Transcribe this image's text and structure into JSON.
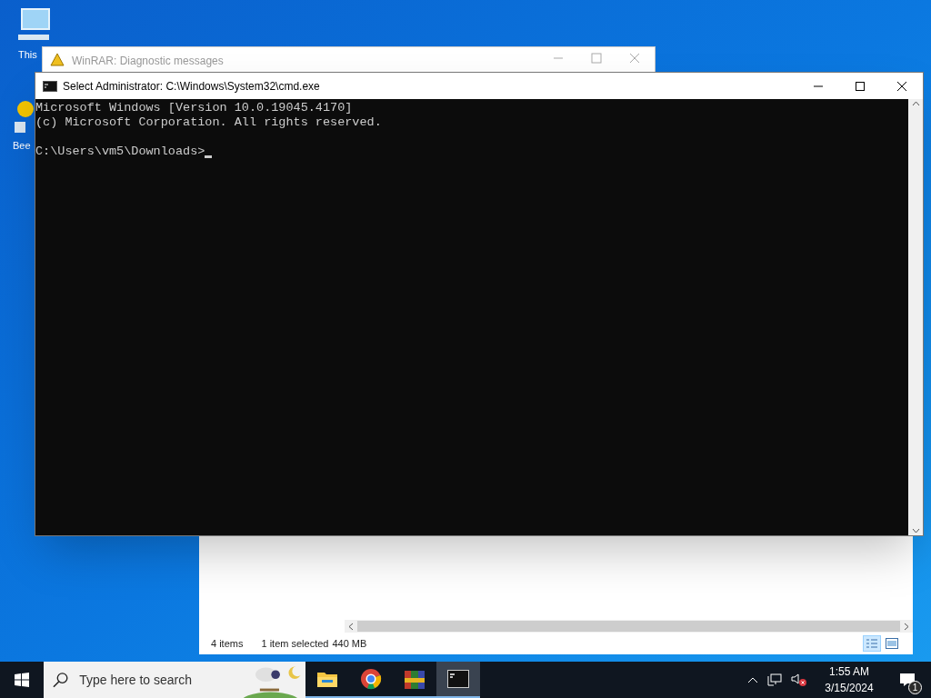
{
  "desktop_icons": [
    {
      "label": "This",
      "kind": "computer"
    },
    {
      "label": "Bee",
      "kind": "app"
    }
  ],
  "winrar_window": {
    "title": "WinRAR: Diagnostic messages"
  },
  "explorer_window": {
    "status": [
      "4 items",
      "1 item selected",
      "440 MB"
    ],
    "views": [
      {
        "kind": "details",
        "selected": true
      },
      {
        "kind": "preview",
        "selected": false
      }
    ]
  },
  "cmd_window": {
    "title": "Select Administrator: C:\\Windows\\System32\\cmd.exe",
    "output_lines": [
      "Microsoft Windows [Version 10.0.19045.4170]",
      "(c) Microsoft Corporation. All rights reserved."
    ],
    "prompt": "C:\\Users\\vm5\\Downloads>"
  },
  "taskbar": {
    "search": {
      "placeholder": "Type here to search"
    },
    "apps": [
      {
        "kind": "folder",
        "selected": false
      },
      {
        "kind": "browser",
        "selected": false
      },
      {
        "kind": "archive",
        "selected": false
      },
      {
        "kind": "terminal",
        "selected": true
      }
    ],
    "clock": {
      "time": "1:55 AM",
      "date": "3/15/2024"
    },
    "notifications": "1"
  }
}
